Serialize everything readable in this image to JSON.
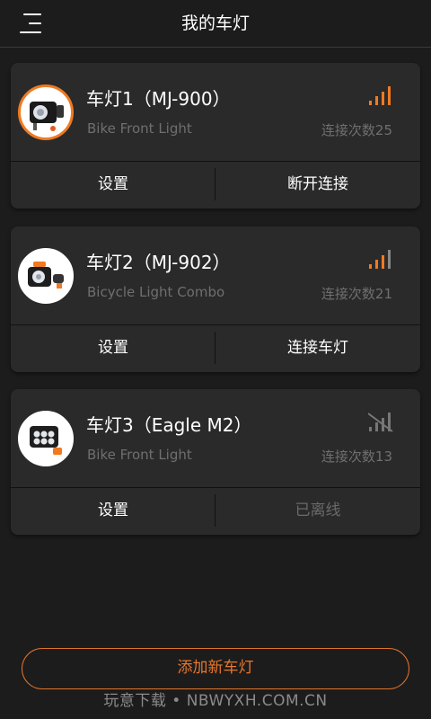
{
  "header": {
    "title": "我的车灯"
  },
  "colors": {
    "accent": "#f07a22",
    "background": "#1c1c1c",
    "card": "#2a2a2a",
    "muted": "#6f6f6f"
  },
  "lights": [
    {
      "name": "车灯1（MJ-900）",
      "subtitle": "Bike Front Light",
      "connection_count": "连接次数25",
      "signal": "connected-signal-icon",
      "settings_label": "设置",
      "action_label": "断开连接",
      "action_enabled": true
    },
    {
      "name": "车灯2（MJ-902）",
      "subtitle": "Bicycle Light Combo",
      "connection_count": "连接次数21",
      "signal": "signal-icon",
      "settings_label": "设置",
      "action_label": "连接车灯",
      "action_enabled": true
    },
    {
      "name": "车灯3（Eagle M2）",
      "subtitle": "Bike Front Light",
      "connection_count": "连接次数13",
      "signal": "no-signal-icon",
      "settings_label": "设置",
      "action_label": "已离线",
      "action_enabled": false
    }
  ],
  "add_button": {
    "label": "添加新车灯"
  },
  "watermark": {
    "text": "玩意下载 • NBWYXH.COM.CN"
  }
}
